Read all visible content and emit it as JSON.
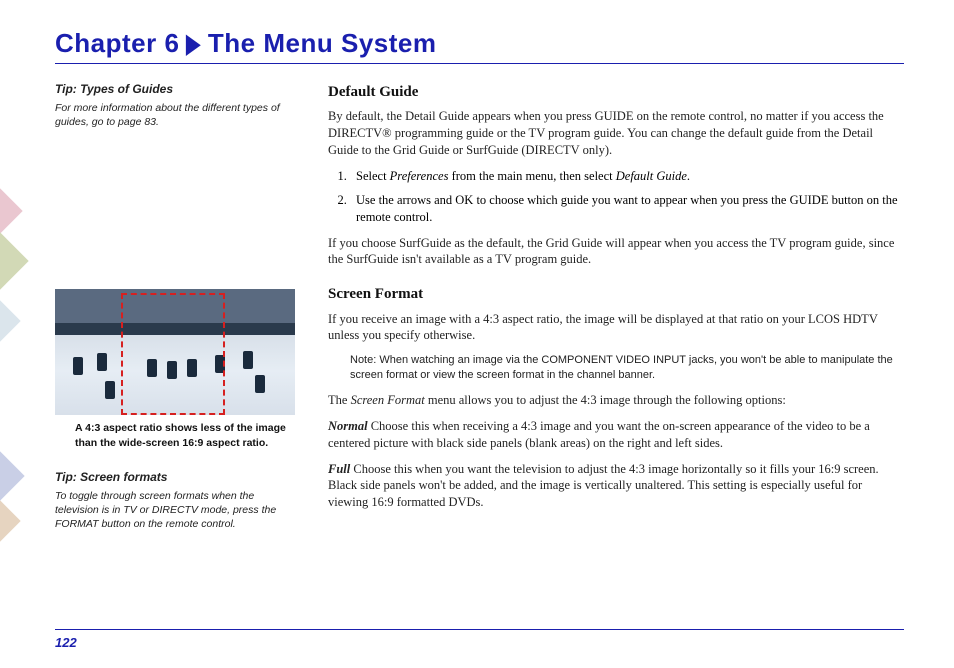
{
  "chapter": {
    "prefix": "Chapter 6",
    "title": "The Menu System"
  },
  "sidebar": {
    "tip1": {
      "title": "Tip: Types of Guides",
      "body": "For more information about the different types of guides, go to page 83."
    },
    "caption": "A 4:3 aspect ratio shows less of the image than the wide-screen 16:9 aspect ratio.",
    "tip2": {
      "title": "Tip: Screen formats",
      "body": "To toggle through screen formats when the television is in TV or DIRECTV mode, press the FORMAT button on the remote control."
    }
  },
  "main": {
    "s1": {
      "title": "Default Guide",
      "p1": "By default, the Detail Guide appears when you press GUIDE on the remote control, no matter if you access the DIRECTV® programming guide or the TV program guide. You can change the default guide from the Detail Guide to the Grid Guide or SurfGuide (DIRECTV only).",
      "li1a": "Select ",
      "li1b": "Preferences",
      "li1c": " from the main menu, then select ",
      "li1d": "Default Guide",
      "li1e": ".",
      "li2": "Use the arrows and OK to choose which guide you want to appear when you press the GUIDE button on the remote control.",
      "p2": "If you choose SurfGuide as the default, the Grid Guide will appear when you access the TV program guide, since the SurfGuide isn't available as a TV program guide."
    },
    "s2": {
      "title": "Screen Format",
      "p1": "If you receive an image with a 4:3 aspect ratio, the image will be displayed at that ratio on your LCOS HDTV unless you specify otherwise.",
      "note": "Note: When watching an image via the COMPONENT VIDEO INPUT jacks, you won't be able to manipulate the screen format or view the screen format in the channel banner.",
      "p2a": "The ",
      "p2b": "Screen Format",
      "p2c": " menu allows you to adjust the 4:3 image through the following options:",
      "opt1label": "Normal",
      "opt1body": "    Choose this when receiving a 4:3 image and you want the on-screen appearance of the video to be a centered picture with black side panels (blank areas) on the right and left sides.",
      "opt2label": "Full",
      "opt2body": "    Choose this when you want the television to adjust the 4:3 image horizontally so it fills your 16:9 screen. Black side panels won't be added, and the image is vertically unaltered. This setting is especially useful for viewing 16:9 formatted DVDs."
    }
  },
  "pageNumber": "122"
}
